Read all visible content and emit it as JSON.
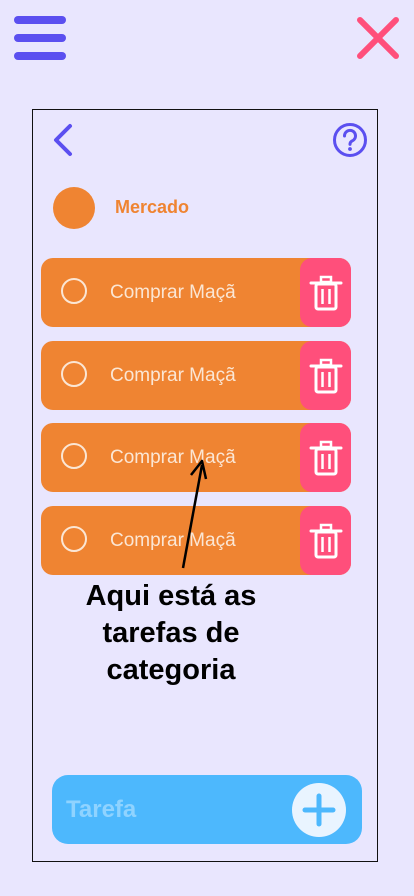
{
  "header": {
    "menu_icon": "hamburger-menu-icon",
    "close_icon": "close-x-icon"
  },
  "nav": {
    "back_icon": "chevron-left-icon",
    "help_icon": "question-circle-icon"
  },
  "category": {
    "name": "Mercado",
    "color": "#ef8432"
  },
  "tasks": [
    {
      "label": "Comprar Maçã",
      "done": false
    },
    {
      "label": "Comprar Maçã",
      "done": false
    },
    {
      "label": "Comprar Maçã",
      "done": false
    },
    {
      "label": "Comprar Maçã",
      "done": false
    }
  ],
  "annotation": {
    "line1": "Aqui está as",
    "line2": "tarefas de",
    "line3": "categoria"
  },
  "add_task": {
    "placeholder": "Tarefa",
    "add_icon": "plus-icon"
  },
  "colors": {
    "background": "#e9e6fe",
    "accent": "#5b4ff0",
    "task": "#ef8432",
    "delete": "#ff4f7b",
    "close": "#ff4f7b",
    "add_bar": "#4db8fd"
  }
}
